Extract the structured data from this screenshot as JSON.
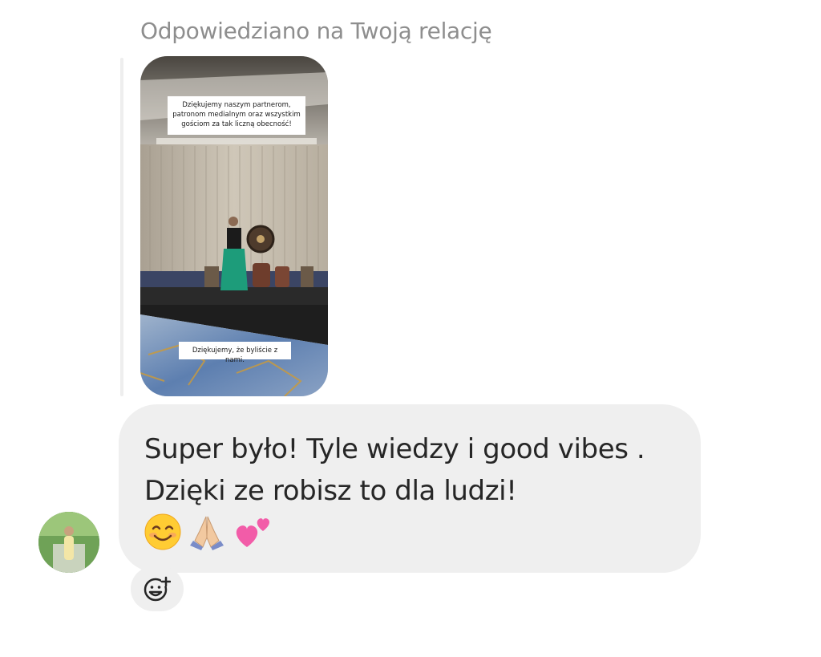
{
  "reply": {
    "label": "Odpowiedziano na Twoją relację"
  },
  "story": {
    "caption_top": "Dziękujemy naszym partnerom, patronom medialnym oraz wszystkim gościom za tak liczną obecność!",
    "caption_bottom": "Dziękujemy, że byliście z nami."
  },
  "message": {
    "text": "Super było! Tyle wiedzy i good vibes . Dzięki ze robisz to dla ludzi!",
    "emojis": [
      "smiling-face-emoji",
      "folded-hands-emoji",
      "two-hearts-emoji"
    ]
  },
  "avatar": {
    "icon": "user-avatar"
  },
  "reaction_button": {
    "icon": "add-reaction-icon"
  },
  "colors": {
    "bubble": "#efefef",
    "label": "#8e8e8e",
    "text": "#262626"
  }
}
